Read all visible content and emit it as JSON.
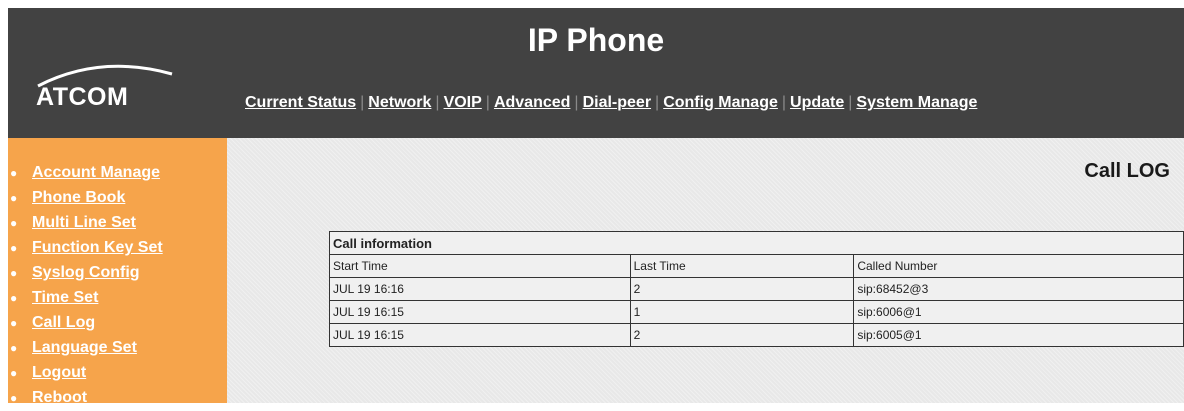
{
  "header": {
    "title": "IP Phone",
    "logo_text": "ATCOM",
    "nav": [
      "Current Status",
      "Network",
      "VOIP",
      "Advanced",
      "Dial-peer",
      "Config Manage",
      "Update",
      "System Manage"
    ]
  },
  "sidebar": {
    "items": [
      "Account Manage",
      "Phone Book",
      "Multi Line Set",
      "Function Key Set",
      "Syslog Config",
      "Time Set",
      "Call Log",
      "Language Set",
      "Logout",
      "Reboot"
    ]
  },
  "main": {
    "title": "Call LOG",
    "table": {
      "caption": "Call information",
      "headers": [
        "Start Time",
        "Last Time",
        "Called Number"
      ],
      "rows": [
        [
          "JUL 19 16:16",
          "2",
          "sip:68452@3"
        ],
        [
          "JUL 19 16:15",
          "1",
          "sip:6006@1"
        ],
        [
          "JUL 19 16:15",
          "2",
          "sip:6005@1"
        ]
      ]
    }
  },
  "colors": {
    "header_bg": "#424242",
    "sidebar_bg": "#f6a44b",
    "main_bg": "#e8e8e8"
  }
}
